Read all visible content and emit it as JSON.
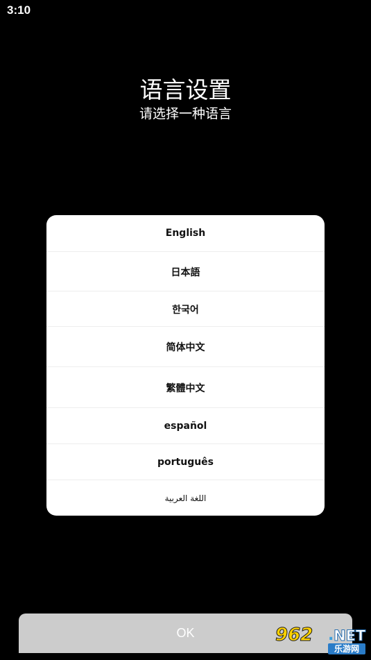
{
  "status_bar": {
    "time": "3:10"
  },
  "header": {
    "title": "语言设置",
    "subtitle": "请选择一种语言"
  },
  "languages": [
    {
      "label": "English"
    },
    {
      "label": "日本語"
    },
    {
      "label": "한국어"
    },
    {
      "label": "简体中文"
    },
    {
      "label": "繁體中文"
    },
    {
      "label": "español"
    },
    {
      "label": "português"
    },
    {
      "label": "اللغة العربية"
    }
  ],
  "actions": {
    "ok_label": "OK"
  },
  "watermark": {
    "number": "962",
    "dot": ".",
    "domain": "NET",
    "site_name": "乐游网"
  },
  "colors": {
    "background": "#000000",
    "card": "#ffffff",
    "button": "#cccccc",
    "watermark_yellow": "#ffd200",
    "watermark_blue": "#2a7cc8"
  }
}
